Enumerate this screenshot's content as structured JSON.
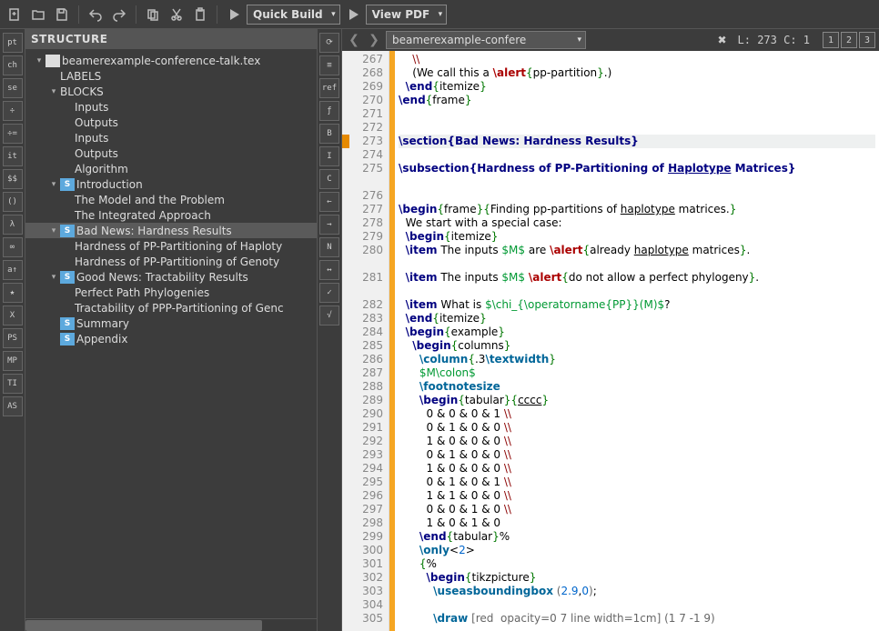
{
  "toolbar": {
    "quick_build": "Quick Build",
    "view_pdf": "View PDF"
  },
  "structure": {
    "title": "STRUCTURE",
    "file": "beamerexample-conference-talk.tex",
    "labels": "LABELS",
    "blocks": "BLOCKS",
    "block_items": [
      "Inputs",
      "Outputs",
      "Inputs",
      "Outputs",
      "Algorithm"
    ],
    "sections": [
      {
        "label": "Introduction",
        "children": [
          "The Model and the Problem",
          "The Integrated Approach"
        ]
      },
      {
        "label": "Bad News: Hardness Results",
        "selected": true,
        "children": [
          "Hardness of PP-Partitioning of Haploty",
          "Hardness of PP-Partitioning of Genoty"
        ]
      },
      {
        "label": "Good News: Tractability Results",
        "children": [
          "Perfect Path Phylogenies",
          "Tractability of PPP-Partitioning of Genc"
        ]
      },
      {
        "label": "Summary",
        "children": []
      },
      {
        "label": "Appendix",
        "children": []
      }
    ]
  },
  "left_buttons": [
    "pt",
    "ch",
    "se",
    "÷",
    "÷=",
    "it",
    "$$",
    "()",
    "λ",
    "∞",
    "a↑",
    "★",
    "X",
    "PS",
    "MP",
    "TI",
    "AS"
  ],
  "mid_buttons": [
    "⟳",
    "≡",
    "ref",
    "ƒ",
    "B",
    "I",
    "C",
    "←",
    "→",
    "N",
    "↔",
    "✓",
    "√"
  ],
  "tabbar": {
    "doc": "beamerexample-confere",
    "cursor": "L: 273 C: 1",
    "splits": [
      "1",
      "2",
      "3"
    ]
  },
  "code_lines": [
    {
      "n": 267,
      "html": "    <span class='env'>\\\\</span>"
    },
    {
      "n": 268,
      "html": "    (We call this a <span class='alert'>\\alert</span><span class='brace'>{</span>pp-partition<span class='brace'>}</span>.)"
    },
    {
      "n": 269,
      "html": "  <span class='navy'>\\end</span><span class='brace'>{</span>itemize<span class='brace'>}</span>"
    },
    {
      "n": 270,
      "html": "<span class='navy'>\\end</span><span class='brace'>{</span>frame<span class='brace'>}</span>"
    },
    {
      "n": 271,
      "html": ""
    },
    {
      "n": 272,
      "html": ""
    },
    {
      "n": 273,
      "html": "<span class='sec'>\\section{Bad News: Hardness Results}</span>",
      "hl": true,
      "mark": true
    },
    {
      "n": 274,
      "html": ""
    },
    {
      "n": 275,
      "html": "<span class='sec'>\\subsection{Hardness of PP-Partitioning of <span class='ul'>Haplotype</span> Matrices}</span>",
      "wrap": true
    },
    {
      "n": 276,
      "html": ""
    },
    {
      "n": 277,
      "html": "<span class='navy'>\\begin</span><span class='brace'>{</span>frame<span class='brace'>}{</span>Finding pp-partitions of <span class='ul'>haplotype</span> matrices.<span class='brace'>}</span>"
    },
    {
      "n": 278,
      "html": "  We start with a special case:"
    },
    {
      "n": 279,
      "html": "  <span class='navy'>\\begin</span><span class='brace'>{</span>itemize<span class='brace'>}</span>"
    },
    {
      "n": 280,
      "html": "  <span class='navy'>\\item</span> The inputs <span class='math'>$M$</span> are <span class='alert'>\\alert</span><span class='brace'>{</span>already <span class='ul'>haplotype</span> matrices<span class='brace'>}</span>.",
      "wrap": true
    },
    {
      "n": 281,
      "html": "  <span class='navy'>\\item</span> The inputs <span class='math'>$M$</span> <span class='alert'>\\alert</span><span class='brace'>{</span>do not allow a perfect phylogeny<span class='brace'>}</span>.",
      "wrap": true
    },
    {
      "n": 282,
      "html": "  <span class='navy'>\\item</span> What is <span class='math'>$\\chi_{\\operatorname{PP}}(M)$</span>?"
    },
    {
      "n": 283,
      "html": "  <span class='navy'>\\end</span><span class='brace'>{</span>itemize<span class='brace'>}</span>"
    },
    {
      "n": 284,
      "html": "  <span class='navy'>\\begin</span><span class='brace'>{</span>example<span class='brace'>}</span>"
    },
    {
      "n": 285,
      "html": "    <span class='navy'>\\begin</span><span class='brace'>{</span>columns<span class='brace'>}</span>"
    },
    {
      "n": 286,
      "html": "      <span class='cmd'>\\column</span><span class='brace'>{</span>.3<span class='cmd'>\\textwidth</span><span class='brace'>}</span>"
    },
    {
      "n": 287,
      "html": "      <span class='math'>$M\\colon$</span>"
    },
    {
      "n": 288,
      "html": "      <span class='cmd'>\\footnotesize</span>"
    },
    {
      "n": 289,
      "html": "      <span class='navy'>\\begin</span><span class='brace'>{</span>tabular<span class='brace'>}{</span><span class='ul'>cccc</span><span class='brace'>}</span>"
    },
    {
      "n": 290,
      "html": "        0 &amp; 0 &amp; 0 &amp; 1 <span class='env'>\\\\</span>"
    },
    {
      "n": 291,
      "html": "        0 &amp; 1 &amp; 0 &amp; 0 <span class='env'>\\\\</span>"
    },
    {
      "n": 292,
      "html": "        1 &amp; 0 &amp; 0 &amp; 0 <span class='env'>\\\\</span>"
    },
    {
      "n": 293,
      "html": "        0 &amp; 1 &amp; 0 &amp; 0 <span class='env'>\\\\</span>"
    },
    {
      "n": 294,
      "html": "        1 &amp; 0 &amp; 0 &amp; 0 <span class='env'>\\\\</span>"
    },
    {
      "n": 295,
      "html": "        0 &amp; 1 &amp; 0 &amp; 1 <span class='env'>\\\\</span>"
    },
    {
      "n": 296,
      "html": "        1 &amp; 1 &amp; 0 &amp; 0 <span class='env'>\\\\</span>"
    },
    {
      "n": 297,
      "html": "        0 &amp; 0 &amp; 1 &amp; 0 <span class='env'>\\\\</span>"
    },
    {
      "n": 298,
      "html": "        1 &amp; 0 &amp; 1 &amp; 0"
    },
    {
      "n": 299,
      "html": "      <span class='navy'>\\end</span><span class='brace'>{</span>tabular<span class='brace'>}</span>%"
    },
    {
      "n": 300,
      "html": "      <span class='cmd'>\\only</span>&lt;<span class='num'>2</span>&gt;"
    },
    {
      "n": 301,
      "html": "      <span class='brace'>{</span>%"
    },
    {
      "n": 302,
      "html": "        <span class='navy'>\\begin</span><span class='brace'>{</span>tikzpicture<span class='brace'>}</span>"
    },
    {
      "n": 303,
      "html": "          <span class='cmd'>\\useasboundingbox</span> <span class='op'>(</span><span class='num'>2.9</span>,<span class='num'>0</span><span class='op'>)</span>;"
    },
    {
      "n": 304,
      "html": ""
    },
    {
      "n": 305,
      "html": "          <span class='cmd'>\\draw</span> <span class='op'>[red  opacity=0 7 line width=1cm] (1 7 -1 9)</span>"
    }
  ]
}
